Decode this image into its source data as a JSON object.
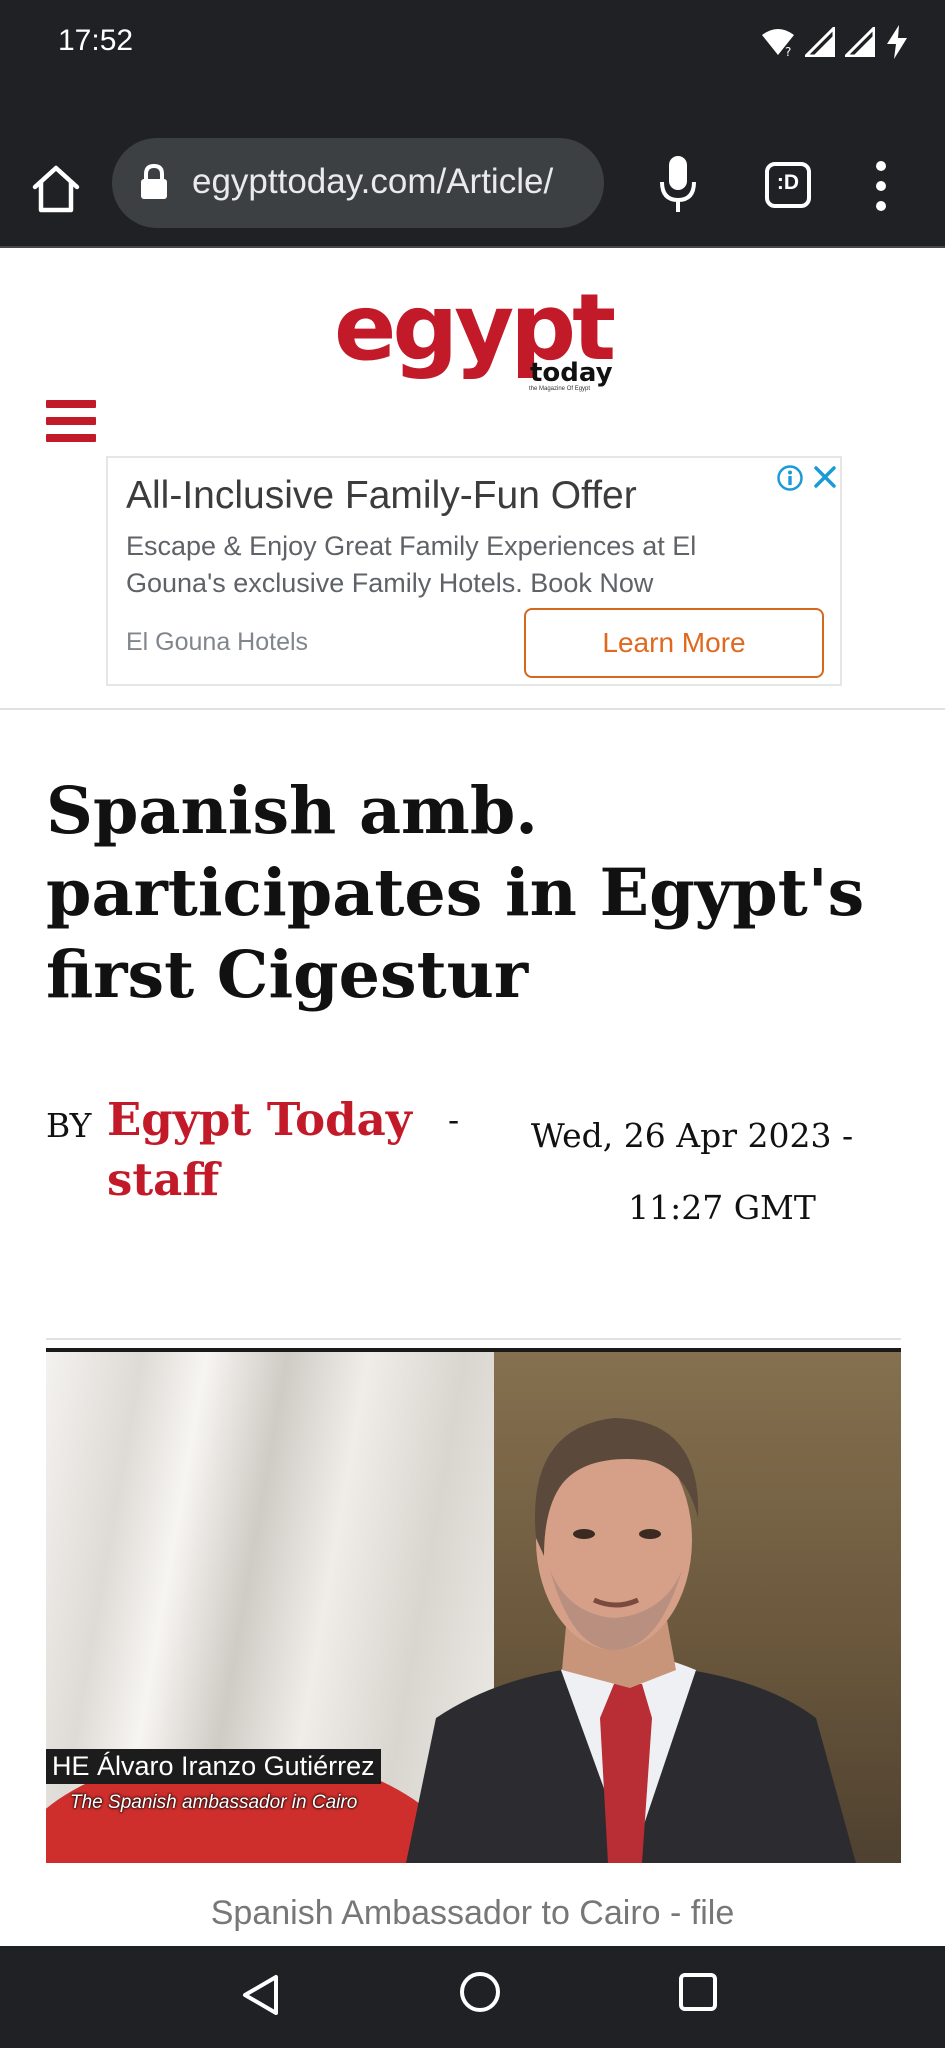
{
  "status_bar": {
    "time": "17:52",
    "icons": [
      "wifi-icon",
      "signal-icon",
      "signal-icon",
      "battery-charging-icon"
    ]
  },
  "browser": {
    "url": "egypttoday.com/Article/",
    "icons": [
      "home-icon",
      "lock-icon",
      "mic-icon",
      "tab-switcher-icon",
      "more-vert-icon"
    ],
    "tab_badge": ":D"
  },
  "site": {
    "logo_main": "egypt",
    "logo_sub": "today",
    "logo_tagline": "the Magazine Of Egypt",
    "brand_color": "#c31a2a"
  },
  "ad": {
    "title": "All-Inclusive Family-Fun Offer",
    "description": "Escape & Enjoy Great Family Experiences at El Gouna's exclusive Family Hotels. Book Now",
    "advertiser": "El Gouna Hotels",
    "cta": "Learn More",
    "icons": [
      "info-icon",
      "close-icon"
    ]
  },
  "article": {
    "headline": "Spanish amb. participates in Egypt's first Cigestur",
    "by_label": "BY",
    "author": "Egypt Today staff",
    "separator": "-",
    "date": "Wed, 26 Apr 2023 -",
    "time": "11:27 GMT",
    "image_overlay_name": "HE Álvaro Iranzo Gutiérrez",
    "image_overlay_role": "The Spanish ambassador in Cairo",
    "image_caption": "Spanish Ambassador to Cairo - file"
  },
  "nav_bar": {
    "icons": [
      "back-icon",
      "home-icon",
      "recents-icon"
    ]
  }
}
